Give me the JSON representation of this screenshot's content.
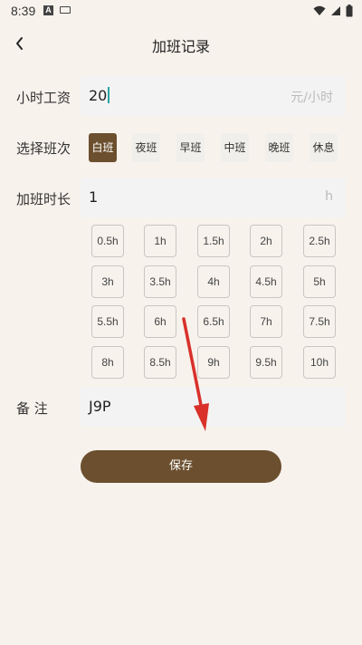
{
  "status": {
    "time": "8:39",
    "a_icon": "A"
  },
  "header": {
    "title": "加班记录"
  },
  "wage": {
    "label": "小时工资",
    "value": "20",
    "unit": "元/小时"
  },
  "shift": {
    "label": "选择班次",
    "options": [
      "白班",
      "夜班",
      "早班",
      "中班",
      "晚班",
      "休息"
    ],
    "selected": "白班"
  },
  "overtime": {
    "label": "加班时长",
    "value": "1",
    "unit": "h"
  },
  "hours": [
    [
      "0.5h",
      "1h",
      "1.5h",
      "2h",
      "2.5h"
    ],
    [
      "3h",
      "3.5h",
      "4h",
      "4.5h",
      "5h"
    ],
    [
      "5.5h",
      "6h",
      "6.5h",
      "7h",
      "7.5h"
    ],
    [
      "8h",
      "8.5h",
      "9h",
      "9.5h",
      "10h"
    ]
  ],
  "note": {
    "label": "备 注",
    "value": "J9P"
  },
  "save": {
    "label": "保存"
  },
  "colors": {
    "accent": "#6b4f2e",
    "background": "#f7f2ec",
    "annotation_arrow": "#d9302a"
  }
}
